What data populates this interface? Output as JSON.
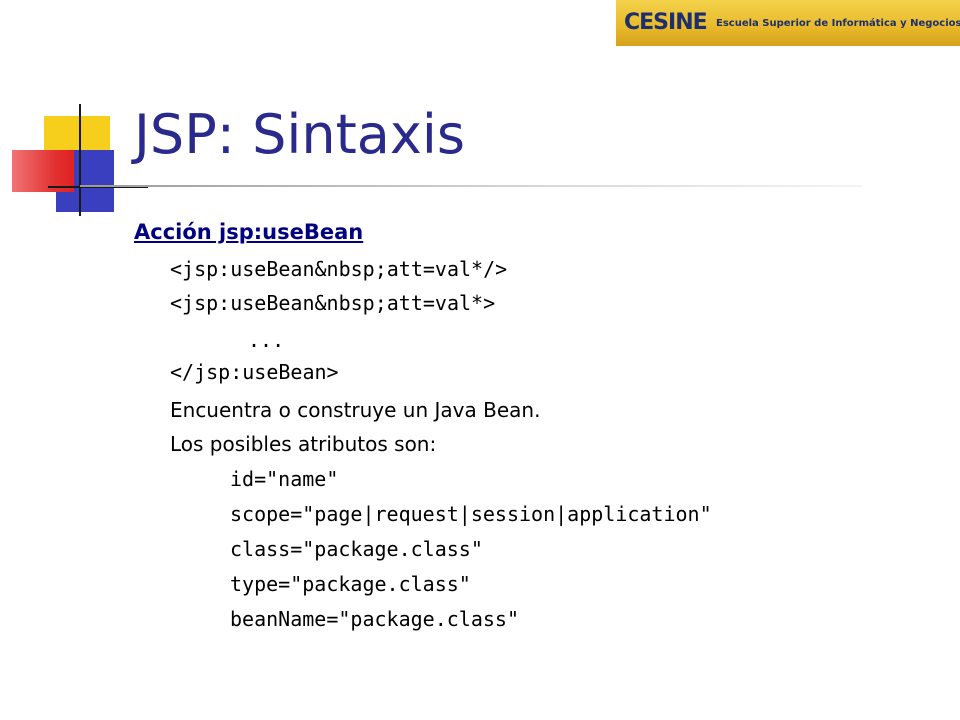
{
  "logo": {
    "mark": "CESINE",
    "tagline": "Escuela Superior de Informática y Negocios"
  },
  "slide": {
    "title": "JSP: Sintaxis",
    "heading": "Acción jsp:useBean",
    "code_lines": [
      "<jsp:useBean&nbsp;att=val*/>",
      "<jsp:useBean&nbsp;att=val*>",
      "...",
      "</jsp:useBean>"
    ],
    "text_lines": [
      "Encuentra o construye un Java Bean.",
      "Los posibles atributos son:"
    ],
    "attributes": [
      "id=\"name\"",
      "scope=\"page|request|session|application\"",
      "class=\"package.class\"",
      "type=\"package.class\"",
      "beanName=\"package.class\""
    ]
  },
  "colors": {
    "title": "#2a2a8c",
    "heading": "#000080",
    "logo_background": "#e8b92a",
    "deco_yellow": "#f5cf1c",
    "deco_blue": "#3a3fbf",
    "deco_red": "#e02222"
  }
}
